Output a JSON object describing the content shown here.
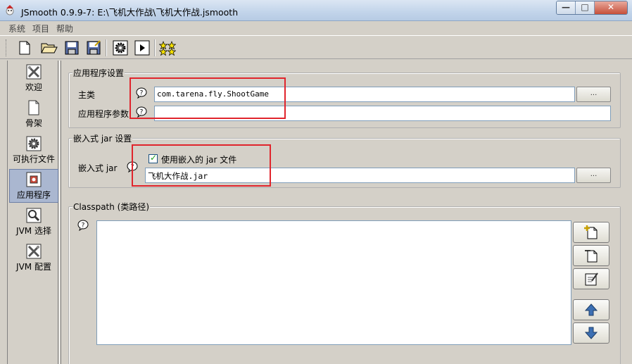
{
  "window": {
    "title": "JSmooth 0.9.9-7: E:\\飞机大作战\\飞机大作战.jsmooth",
    "minimize_label": "—",
    "maximize_label": "□",
    "close_label": "✕"
  },
  "menu": [
    "系统",
    "项目",
    "帮助"
  ],
  "toolbar": {
    "icons": [
      "new-file-icon",
      "open-folder-icon",
      "save-icon",
      "save-as-icon",
      "compile-gear-icon",
      "run-icon",
      "about-stars-icon"
    ]
  },
  "sidebar": {
    "items": [
      {
        "label": "欢迎",
        "icon": "tools-icon"
      },
      {
        "label": "骨架",
        "icon": "skeleton-page-icon"
      },
      {
        "label": "可执行文件",
        "icon": "gear-icon"
      },
      {
        "label": "应用程序",
        "icon": "application-icon",
        "active": true
      },
      {
        "label": "JVM 选择",
        "icon": "magnifier-icon"
      },
      {
        "label": "JVM 配置",
        "icon": "tools-icon"
      }
    ]
  },
  "app_settings": {
    "title": "应用程序设置",
    "main_class_label": "主类",
    "main_class_value": "com.tarena.fly.ShootGame",
    "args_label": "应用程序参数",
    "args_value": "",
    "browse_label": "..."
  },
  "embedded_jar": {
    "title": "嵌入式 jar 设置",
    "label": "嵌入式 jar",
    "use_embedded_label": "使用嵌入的 jar 文件",
    "use_embedded_checked": true,
    "jar_path": "飞机大作战.jar",
    "browse_label": "..."
  },
  "classpath": {
    "title": "Classpath (类路径)",
    "entries": []
  },
  "colors": {
    "highlight_box": "#e0242c",
    "active_nav": "#aab7d0"
  }
}
